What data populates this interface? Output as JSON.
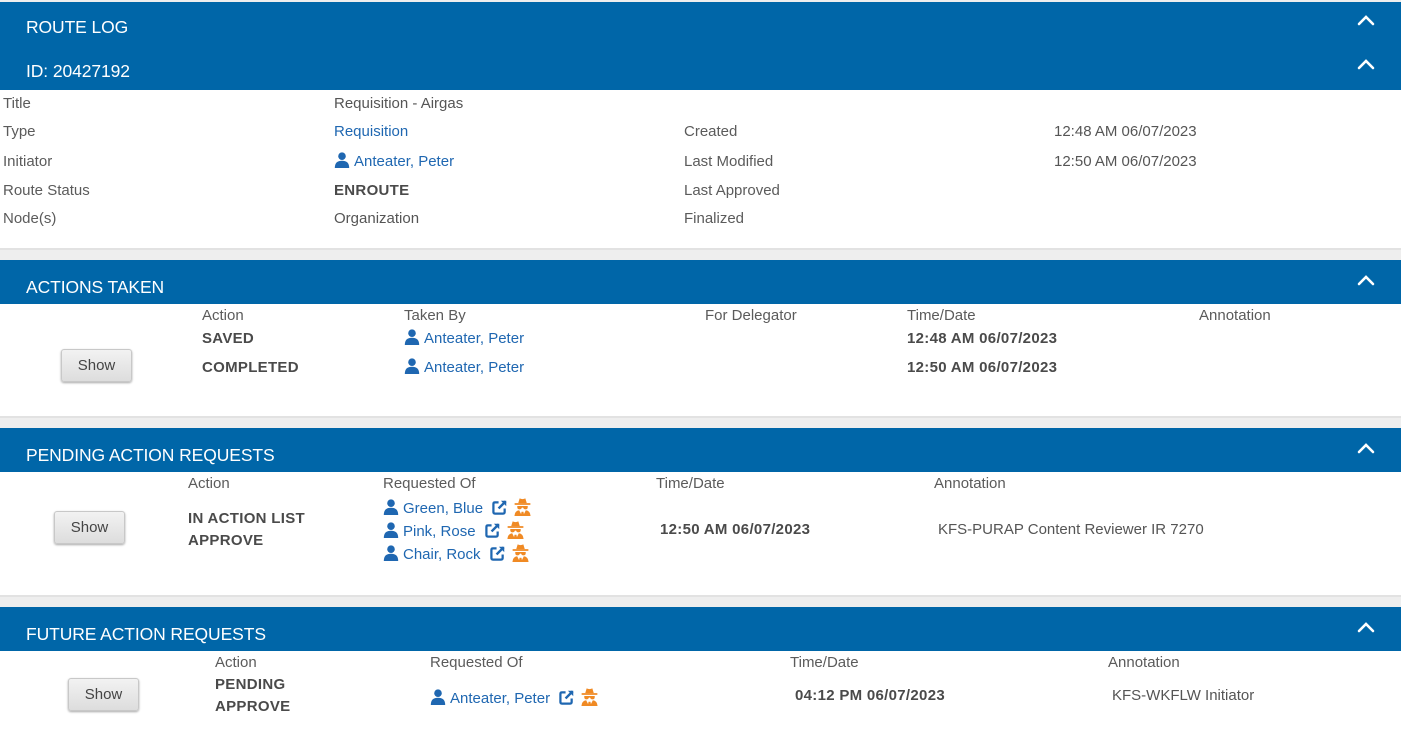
{
  "route_log": {
    "title": "ROUTE LOG"
  },
  "doc_header": {
    "title": "ID: 20427192"
  },
  "doc_info": {
    "title_label": "Title",
    "title_value": "Requisition - Airgas",
    "type_label": "Type",
    "type_value": "Requisition",
    "initiator_label": "Initiator",
    "initiator_value": "Anteater, Peter",
    "route_status_label": "Route Status",
    "route_status_value": "ENROUTE",
    "nodes_label": "Node(s)",
    "nodes_value": "Organization",
    "created_label": "Created",
    "created_value": "12:48 AM 06/07/2023",
    "last_modified_label": "Last Modified",
    "last_modified_value": "12:50 AM 06/07/2023",
    "last_approved_label": "Last Approved",
    "finalized_label": "Finalized"
  },
  "actions_taken": {
    "title": "ACTIONS TAKEN",
    "show_label": "Show",
    "columns": [
      "Action",
      "Taken By",
      "For Delegator",
      "Time/Date",
      "Annotation"
    ],
    "rows": [
      {
        "action": "SAVED",
        "taken_by": "Anteater, Peter",
        "time": "12:48 AM 06/07/2023"
      },
      {
        "action": "COMPLETED",
        "taken_by": "Anteater, Peter",
        "time": "12:50 AM 06/07/2023"
      }
    ]
  },
  "pending": {
    "title": "PENDING ACTION REQUESTS",
    "show_label": "Show",
    "columns": [
      "Action",
      "Requested Of",
      "Time/Date",
      "Annotation"
    ],
    "action_line1": "IN ACTION LIST",
    "action_line2": "APPROVE",
    "requested_of": [
      "Green, Blue",
      "Pink, Rose",
      "Chair, Rock"
    ],
    "time": "12:50 AM 06/07/2023",
    "annotation": "KFS-PURAP Content Reviewer IR 7270"
  },
  "future": {
    "title": "FUTURE ACTION REQUESTS",
    "show_label": "Show",
    "columns": [
      "Action",
      "Requested Of",
      "Time/Date",
      "Annotation"
    ],
    "action_line1": "PENDING",
    "action_line2": "APPROVE",
    "requested_of": "Anteater, Peter",
    "time": "04:12 PM 06/07/2023",
    "annotation": "KFS-WKFLW Initiator"
  },
  "colors": {
    "header_bar": "#0066a8",
    "link": "#1f67b1",
    "spy_icon": "#f08a24"
  },
  "icons": [
    "chevron-up-icon",
    "person-icon",
    "external-link-icon",
    "spy-icon"
  ]
}
